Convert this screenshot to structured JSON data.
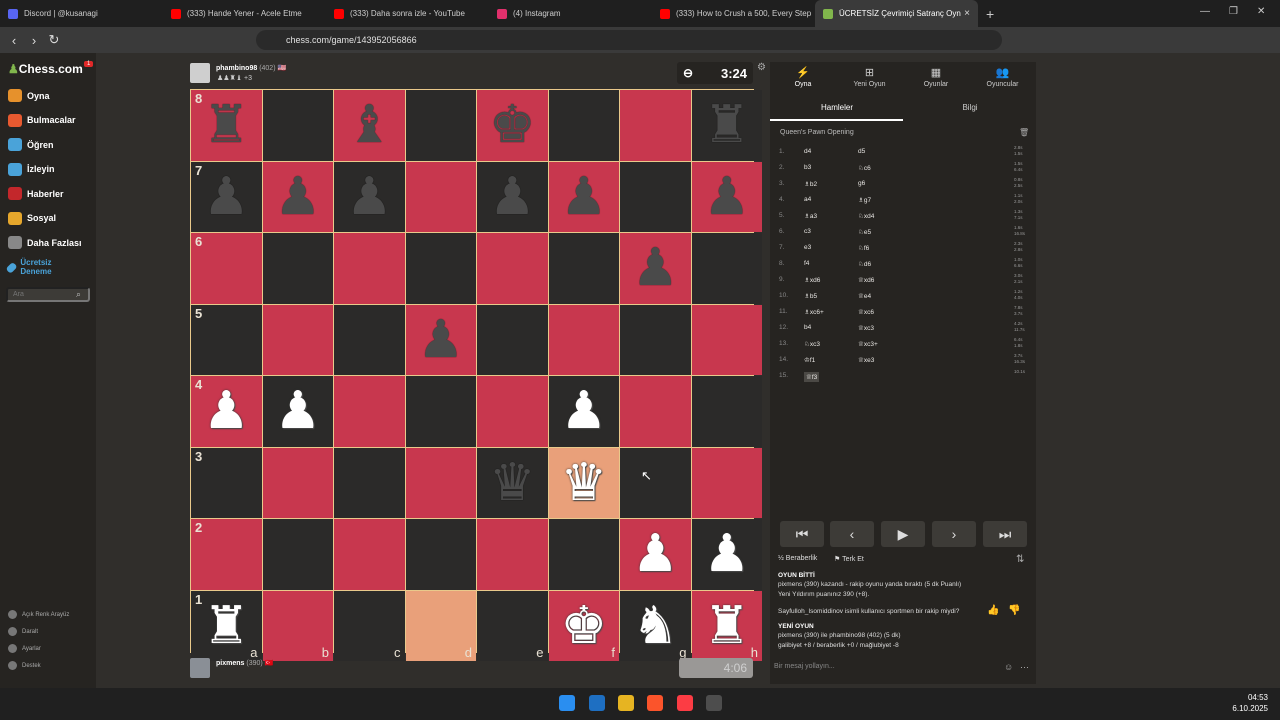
{
  "browser": {
    "tabs": [
      {
        "title": "Discord | @kusanagi",
        "color": "#5865f2"
      },
      {
        "title": "(333) Hande Yener - Acele Etme",
        "color": "#ff0000"
      },
      {
        "title": "(333) Daha sonra izle - YouTube",
        "color": "#ff0000"
      },
      {
        "title": "(4) Instagram",
        "color": "#e1306c"
      },
      {
        "title": "(333) How to Crush a 500, Every Step",
        "color": "#ff0000"
      },
      {
        "title": "ÜCRETSİZ Çevrimiçi Satranç Oyn",
        "color": "#81b64c"
      }
    ],
    "url": "chess.com/game/143952056866",
    "new_tab": "+",
    "close": "×"
  },
  "sidebar": {
    "logo": "Chess.com",
    "badge": "1",
    "items": [
      {
        "label": "Oyna",
        "color": "#e6912c"
      },
      {
        "label": "Bulmacalar",
        "color": "#e85a30"
      },
      {
        "label": "Öğren",
        "color": "#4aa3d9"
      },
      {
        "label": "İzleyin",
        "color": "#4aa3d9"
      },
      {
        "label": "Haberler",
        "color": "#c3272b"
      },
      {
        "label": "Sosyal",
        "color": "#e6a72c"
      },
      {
        "label": "Daha Fazlası",
        "color": "#888888"
      }
    ],
    "trial": "Ücretsiz Deneme",
    "search_placeholder": "Ara",
    "bottom": [
      "Açık Renk Arayüz",
      "Daralt",
      "Ayarlar",
      "Destek"
    ]
  },
  "players": {
    "top": {
      "name": "phambino98",
      "rating": "(402)",
      "flag": "🇺🇸",
      "captured": "♟♟♜♝ +3",
      "clock": "3:24"
    },
    "bottom": {
      "name": "pixmens",
      "rating": "(390)",
      "flag": "🇹🇷",
      "clock": "4:06"
    }
  },
  "board": {
    "ranks": [
      "8",
      "7",
      "6",
      "5",
      "4",
      "3",
      "2",
      "1"
    ],
    "files": [
      "a",
      "b",
      "c",
      "d",
      "e",
      "f",
      "g",
      "h"
    ],
    "rows": [
      [
        "br",
        "",
        "bb",
        "",
        "bk",
        "",
        "",
        "br"
      ],
      [
        "bp",
        "bp",
        "bp",
        "",
        "bp",
        "bp",
        "",
        "bp"
      ],
      [
        "",
        "",
        "",
        "",
        "",
        "",
        "bp",
        ""
      ],
      [
        "",
        "",
        "",
        "bp",
        "",
        "",
        "",
        ""
      ],
      [
        "wp",
        "wp",
        "",
        "",
        "",
        "wp",
        "",
        ""
      ],
      [
        "",
        "",
        "",
        "",
        "bq",
        "wq",
        "",
        ""
      ],
      [
        "",
        "",
        "",
        "",
        "",
        "",
        "wp",
        "wp"
      ],
      [
        "wr",
        "",
        "",
        "",
        "",
        "wk",
        "wn",
        "wr"
      ]
    ],
    "highlight": [
      "d1",
      "f3"
    ]
  },
  "panel": {
    "tabs": [
      "Oyna",
      "Yeni Oyun",
      "Oyunlar",
      "Oyuncular"
    ],
    "subtabs": [
      "Hamleler",
      "Bilgi"
    ],
    "opening": "Queen's Pawn Opening",
    "moves": [
      {
        "n": "1.",
        "w": "d4",
        "b": "d5",
        "tw": "2.8s",
        "tb": "1.5s"
      },
      {
        "n": "2.",
        "w": "b3",
        "b": "♘c6",
        "tw": "1.5s",
        "tb": "6.4s"
      },
      {
        "n": "3.",
        "w": "♗b2",
        "b": "g6",
        "tw": "0.8s",
        "tb": "2.5s"
      },
      {
        "n": "4.",
        "w": "a4",
        "b": "♗g7",
        "tw": "1.1s",
        "tb": "2.0s"
      },
      {
        "n": "5.",
        "w": "♗a3",
        "b": "♘xd4",
        "tw": "1.3s",
        "tb": "7.1s"
      },
      {
        "n": "6.",
        "w": "c3",
        "b": "♘e5",
        "tw": "1.6s",
        "tb": "16.8s"
      },
      {
        "n": "7.",
        "w": "e3",
        "b": "♘f6",
        "tw": "2.3s",
        "tb": "2.8s"
      },
      {
        "n": "8.",
        "w": "f4",
        "b": "♘d6",
        "tw": "1.0s",
        "tb": "6.6s"
      },
      {
        "n": "9.",
        "w": "♗xd6",
        "b": "♕xd6",
        "tw": "3.0s",
        "tb": "2.1s"
      },
      {
        "n": "10.",
        "w": "♗b5",
        "b": "♕e4",
        "tw": "1.2s",
        "tb": "4.0s"
      },
      {
        "n": "11.",
        "w": "♗xc6+",
        "b": "♕xc6",
        "tw": "7.8s",
        "tb": "3.7s"
      },
      {
        "n": "12.",
        "w": "b4",
        "b": "♕xc3",
        "tw": "4.2s",
        "tb": "11.7s"
      },
      {
        "n": "13.",
        "w": "♘xc3",
        "b": "♕xc3+",
        "tw": "6.4s",
        "tb": "1.8s"
      },
      {
        "n": "14.",
        "w": "♔f1",
        "b": "♕xe3",
        "tw": "3.7s",
        "tb": "16.3s"
      },
      {
        "n": "15.",
        "w": "♕f3",
        "b": "",
        "tw": "10.1s",
        "tb": ""
      }
    ],
    "actions": [
      "Beraberlik",
      "Terk Et"
    ],
    "chat": [
      {
        "t": "OYUN BİTTİ",
        "bold": true
      },
      {
        "t": "pixmens (390) kazandı - rakip oyunu yanda bıraktı (5 dk Puanlı)",
        "bold": false
      },
      {
        "t": "Yeni Yıldırım puanınız 390 (+8).",
        "bold": false
      },
      {
        "t": "Sayfulloh_Isomiddinov isimli kullanıcı sportmen bir rakip miydi?",
        "bold": false
      },
      {
        "t": "YENİ OYUN",
        "bold": true
      },
      {
        "t": "pixmens (390) ile phambino98 (402) (5 dk)",
        "bold": false
      },
      {
        "t": "galibiyet +8 / beraberlik +0 / mağlubiyet -8",
        "bold": false
      }
    ],
    "message_placeholder": "Bir mesaj yollayın..."
  },
  "taskbar": {
    "time": "04:53",
    "date": "6.10.2025"
  }
}
